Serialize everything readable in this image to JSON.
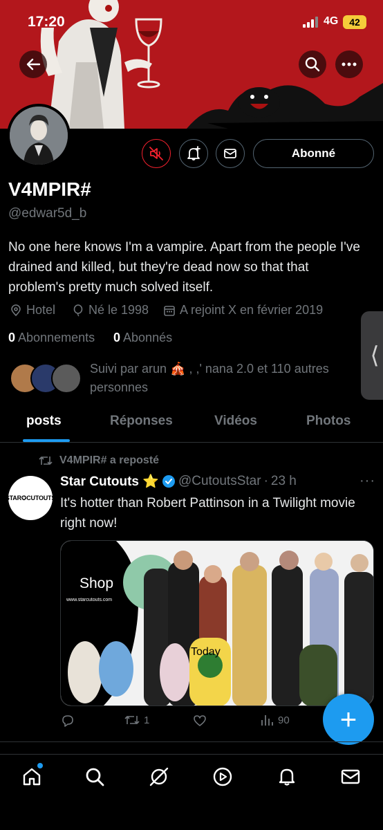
{
  "status_bar": {
    "time": "17:20",
    "network": "4G",
    "battery": "42"
  },
  "profile": {
    "name": "V4MPIR#",
    "handle": "@edwar5d_b",
    "bio": "No one here knows I'm a vampire. Apart from the people I've drained and killed, but they're dead now so that that problem's pretty much solved itself.",
    "location": "Hotel",
    "born": "Né le 1998",
    "joined": "A rejoint X en février 2019",
    "following_count": "0",
    "following_label": "Abonnements",
    "followers_count": "0",
    "followers_label": "Abonnés",
    "followed_by": "Suivi par arun 🎪 , ,' nana 2.0 et 110 autres personnes",
    "follow_button": "Abonné"
  },
  "tabs": [
    {
      "label": "posts",
      "active": true
    },
    {
      "label": "Réponses",
      "active": false
    },
    {
      "label": "Vidéos",
      "active": false
    },
    {
      "label": "Photos",
      "active": false
    }
  ],
  "post": {
    "repost_label": "V4MPIR# a reposté",
    "avatar_text": "STAR✪CUTOUTS",
    "author": "Star Cutouts ⭐",
    "handle": "@CutoutsStar",
    "separator": "·",
    "time": "23 h",
    "more": "···",
    "text": "It's hotter than Robert Pattinson in a Twilight movie right now!",
    "image": {
      "shop_label": "Shop",
      "url_label": "www.starcutouts.com",
      "today_label": "Today"
    },
    "reposts": "1",
    "views": "90"
  },
  "fab_label": "+",
  "side_handle_label": "⟨",
  "colors": {
    "accent": "#1d9bf0",
    "banner": "#b3171c",
    "mute_red": "#f4212e"
  },
  "icons": {
    "back": "back-arrow-icon",
    "search": "search-icon",
    "more": "more-icon",
    "mute": "mute-icon",
    "notify": "bell-plus-icon",
    "message": "mail-icon"
  }
}
